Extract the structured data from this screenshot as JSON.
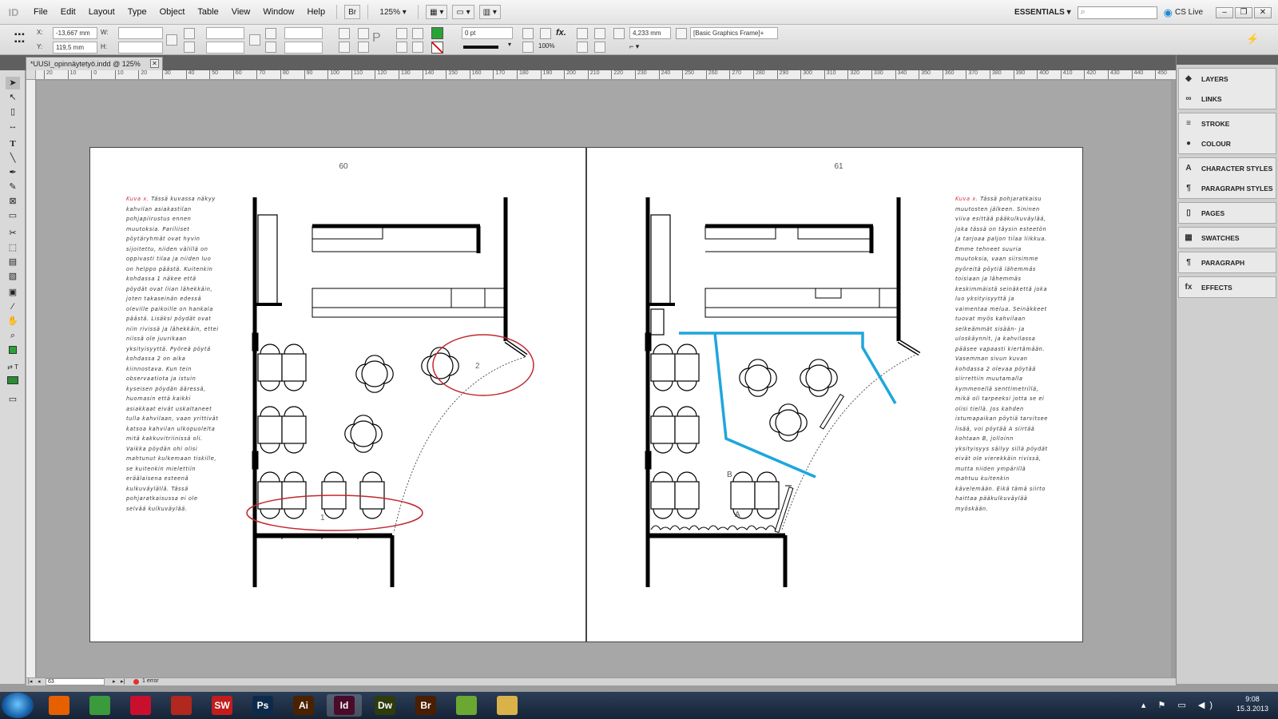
{
  "app": {
    "logo": "ID",
    "menus": [
      "File",
      "Edit",
      "Layout",
      "Type",
      "Object",
      "Table",
      "View",
      "Window",
      "Help"
    ],
    "bridge_button": "Br",
    "zoom": "125%",
    "workspace": "ESSENTIALS",
    "search_placeholder": "",
    "cs_live": "CS Live"
  },
  "control_panel": {
    "x_label": "X:",
    "x_value": "-13,667 mm",
    "y_label": "Y:",
    "y_value": "119,5 mm",
    "w_label": "W:",
    "h_label": "H:",
    "stroke_weight": "0 pt",
    "opacity": "100%",
    "fx": "fx.",
    "ref_value": "4,233 mm",
    "object_style": "[Basic Graphics Frame]+"
  },
  "document": {
    "tab_title": "*UUSI_opinnäytetyö.indd @ 125%",
    "ruler_numbers": [
      "20",
      "10",
      "0",
      "10",
      "20",
      "30",
      "40",
      "50",
      "60",
      "70",
      "80",
      "90",
      "100",
      "110",
      "120",
      "130",
      "140",
      "150",
      "160",
      "170",
      "180",
      "190",
      "200",
      "210",
      "220",
      "230",
      "240",
      "250",
      "260",
      "270",
      "280",
      "290",
      "300",
      "310",
      "320",
      "330",
      "340",
      "350",
      "360",
      "370",
      "380",
      "390",
      "400",
      "410",
      "420",
      "430",
      "440",
      "450"
    ],
    "left_page": {
      "number": "60",
      "caption_lead": "Kuva x.",
      "caption_body": " Tässä kuvassa näkyy kahvilan asiakastilan pohjapiirustus ennen muutoksia. Pariliiset pöytäryhmät ovat hyvin sijoitettu, niiden välillä on oppivasti tilaa ja niiden luo on helppo päästä. Kuitenkin kohdassa 1 näkee että pöydät ovat liian lähekkäin, joten takaseinän edessä oleville paikoille on hankala päästä. Lisäksi pöydät ovat niin rivissä ja lähekkäin, ettei niissä ole juurikaan yksityisyyttä. Pyöreä pöytä kohdassa 2 on aika kiinnostava. Kun tein observaatiota ja istuin kyseisen pöydän ääressä, huomasin että kaikki asiakkaat eivät uskaltaneet tulla kahvilaan, vaan yrittivät katsoa kahvilan ulkopuolelta mitä kakkuvitriinissä oli. Vaikka pöydän ohi olisi mahtunut kulkemaan tiskille, se kuitenkin mielettiin eräälaisena esteenä kulkuväylällä. Tässä pohjaratkaisussa ei ole selvää kulkuväylää.",
      "label_1": "1",
      "label_2": "2"
    },
    "right_page": {
      "number": "61",
      "caption_lead": "Kuva x.",
      "caption_body": " Tässä pohjaratkaisu muutosten jälkeen. Sininen viiva esittää pääkulkuväylää, joka tässä on täysin esteetön ja tarjoaa paljon tilaa liikkua. Emme tehneet suuria muutoksia, vaan siirsimme pyöreitä pöytiä lähemmäs toisiaan ja lähemmäs keskimmäistä seinäkettä joka luo yksityisyyttä ja vaimentaa melua. Seinäkkeet tuovat myös kahvilaan selkeämmät sisään- ja uloskäynnit, ja kahvilassa pääsee vapaasti kiertämään. Vasemman sivun kuvan kohdassa 2 olevaa pöytää siirrettiin muutamalla kymmenellä senttimetrillä, mikä oli tarpeeksi jotta se ei olisi tiellä. Jos kahden istumapaikan pöytiä tarvitsee lisää, voi pöytää A siirtää kohtaan B, jolloinn yksityisyys säilyy sillä pöydät eivät ole vierekkäin rivissä, mutta niiden ympärillä mahtuu kuitenkin kävelemään. Eikä tämä siirto haittaa pääkulkuväylää myöskään.",
      "label_a": "A",
      "label_b": "B"
    }
  },
  "panels": [
    {
      "items": [
        {
          "icon": "layers-icon",
          "glyph": "◆",
          "label": "LAYERS"
        },
        {
          "icon": "links-icon",
          "glyph": "∞",
          "label": "LINKS"
        }
      ]
    },
    {
      "items": [
        {
          "icon": "stroke-icon",
          "glyph": "≡",
          "label": "STROKE"
        },
        {
          "icon": "colour-icon",
          "glyph": "●",
          "label": "COLOUR"
        }
      ]
    },
    {
      "items": [
        {
          "icon": "character-styles-icon",
          "glyph": "A",
          "label": "CHARACTER STYLES"
        },
        {
          "icon": "paragraph-styles-icon",
          "glyph": "¶",
          "label": "PARAGRAPH STYLES"
        }
      ]
    },
    {
      "items": [
        {
          "icon": "pages-icon",
          "glyph": "▯",
          "label": "PAGES"
        }
      ]
    },
    {
      "items": [
        {
          "icon": "swatches-icon",
          "glyph": "▦",
          "label": "SWATCHES"
        }
      ]
    },
    {
      "items": [
        {
          "icon": "paragraph-icon",
          "glyph": "¶",
          "label": "PARAGRAPH"
        }
      ]
    },
    {
      "items": [
        {
          "icon": "effects-icon",
          "glyph": "fx",
          "label": "EFFECTS"
        }
      ]
    }
  ],
  "status": {
    "page_field": "63",
    "preflight": "1 error"
  },
  "taskbar": {
    "apps": [
      {
        "name": "firefox",
        "label": "",
        "color": "#e66000"
      },
      {
        "name": "chrome",
        "label": "",
        "color": "#3b9a3b"
      },
      {
        "name": "photo-booth",
        "label": "",
        "color": "#c8102e"
      },
      {
        "name": "globe",
        "label": "",
        "color": "#b0281e"
      },
      {
        "name": "shockwave",
        "label": "SW",
        "color": "#c21d1d"
      },
      {
        "name": "photoshop",
        "label": "Ps",
        "color": "#0d2a4b"
      },
      {
        "name": "illustrator",
        "label": "Ai",
        "color": "#4a2200"
      },
      {
        "name": "indesign",
        "label": "Id",
        "color": "#4a0b2a"
      },
      {
        "name": "dreamweaver",
        "label": "Dw",
        "color": "#2e3b0c"
      },
      {
        "name": "bridge",
        "label": "Br",
        "color": "#4a1e00"
      },
      {
        "name": "sketch",
        "label": "",
        "color": "#6aa832"
      },
      {
        "name": "explorer",
        "label": "",
        "color": "#d9b24a"
      }
    ],
    "time": "9:08",
    "date": "15.3.2013"
  }
}
